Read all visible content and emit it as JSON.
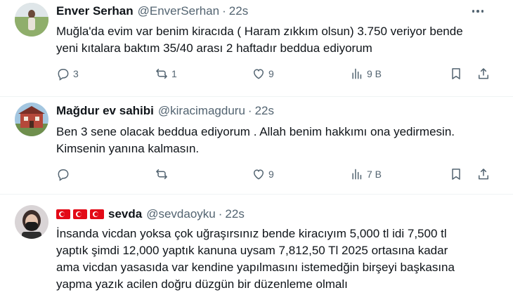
{
  "tweets": [
    {
      "name": "Enver Serhan",
      "handle": "@EnverSerhan",
      "dot": "·",
      "time": "22s",
      "text": [
        "Muğla'da evim var benim kiracıda ( Haram zıkkım olsun) 3.750 veriyor bende",
        "yeni kıtalara baktım 35/40 arası 2 haftadır beddua ediyorum"
      ],
      "replies": "3",
      "retweets": "1",
      "likes": "9",
      "views": "9 B"
    },
    {
      "name": "Mağdur ev sahibi",
      "handle": "@kiracimagduru",
      "dot": "·",
      "time": "22s",
      "text": [
        "Ben 3 sene olacak beddua ediyorum . Allah benim hakkımı ona yedirmesin.",
        "Kimsenin yanına kalmasın."
      ],
      "replies": "",
      "retweets": "",
      "likes": "9",
      "views": "7 B"
    },
    {
      "name": "sevda",
      "handle": "@sevdaoyku",
      "dot": "·",
      "time": "22s",
      "text": [
        "İnsanda vicdan yoksa çok uğraşırsınız bende kiracıyım 5,000 tl idi 7,500 tl",
        "yaptık şimdi 12,000 yaptık kanuna uysam 7,812,50 Tl 2025 ortasına kadar",
        "ama vicdan yasasıda var kendine yapılmasını istemedğin birşeyi başkasına",
        "yapma yazık acilen doğru düzgün bir düzenleme olmalı"
      ]
    }
  ],
  "icons": {
    "reply": "reply-icon",
    "retweet": "retweet-icon",
    "like": "heart-icon",
    "views": "views-icon",
    "bookmark": "bookmark-icon",
    "share": "share-icon",
    "more": "more-icon",
    "flags": "turkish-flag-icon"
  },
  "colors": {
    "text": "#0f1419",
    "secondary": "#536471",
    "divider": "#eff3f4",
    "flag": "#e30a17"
  }
}
